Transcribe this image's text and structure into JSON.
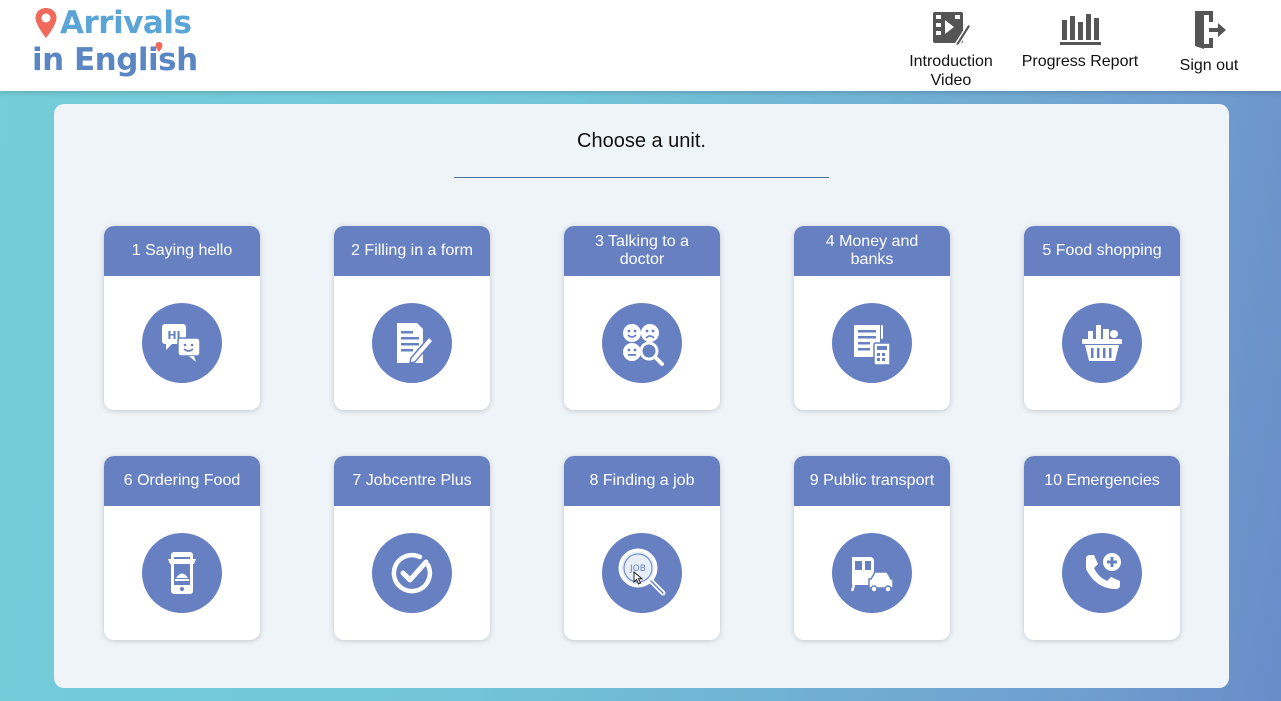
{
  "brand": {
    "line1": "Arrivals",
    "line2": "in English",
    "accent_color": "#ef6a5a",
    "primary_color": "#5a86c4"
  },
  "nav": {
    "intro_video": "Introduction Video",
    "progress_report": "Progress Report",
    "sign_out": "Sign out"
  },
  "main": {
    "title": "Choose a unit.",
    "units": [
      {
        "label": "1 Saying hello",
        "icon": "speech-bubbles-icon"
      },
      {
        "label": "2 Filling in a form",
        "icon": "form-pencil-icon"
      },
      {
        "label": "3 Talking to a doctor",
        "icon": "faces-magnifier-icon"
      },
      {
        "label": "4 Money and banks",
        "icon": "document-calculator-icon"
      },
      {
        "label": "5 Food shopping",
        "icon": "shopping-basket-icon"
      },
      {
        "label": "6 Ordering Food",
        "icon": "phone-food-icon"
      },
      {
        "label": "7 Jobcentre Plus",
        "icon": "check-circle-icon"
      },
      {
        "label": "8 Finding a job",
        "icon": "job-search-icon"
      },
      {
        "label": "9 Public transport",
        "icon": "train-car-icon"
      },
      {
        "label": "10 Emergencies",
        "icon": "phone-plus-icon"
      }
    ]
  },
  "colors": {
    "card_header": "#6680c2",
    "panel_bg": "#eef4f8"
  }
}
